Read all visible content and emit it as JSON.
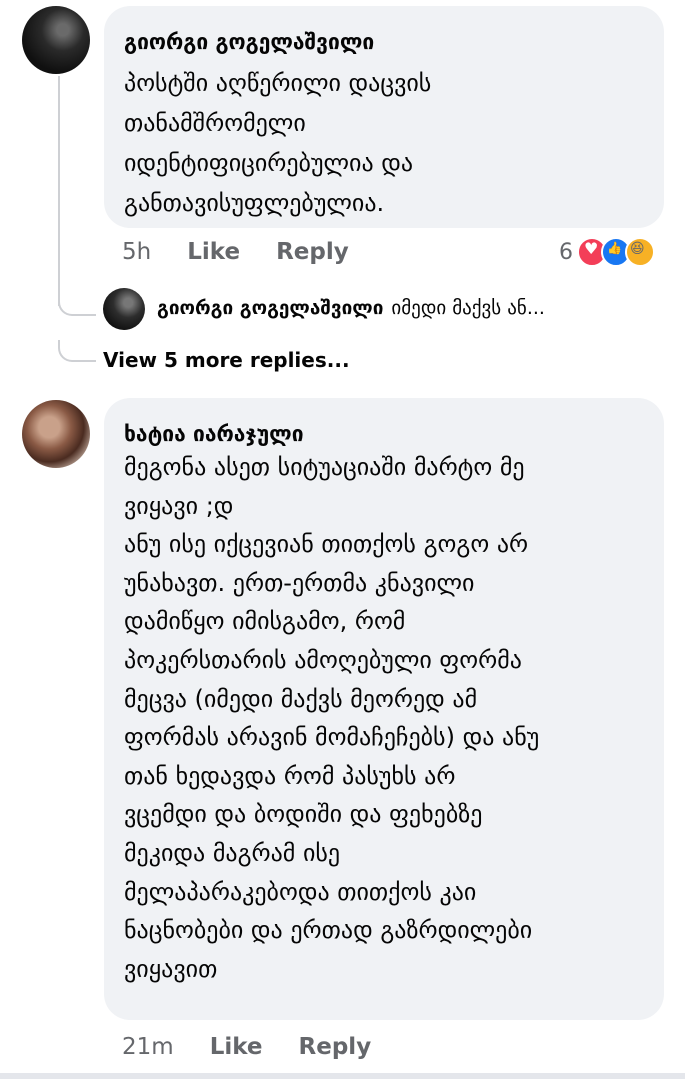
{
  "comments": [
    {
      "author": "გიორგი გოგელაშვილი",
      "text": "პოსტში აღწერილი დაცვის\nთანამშრომელი\nიდენტიფიცირებულია და\nგანთავისუფლებულია.",
      "time": "5h",
      "like_label": "Like",
      "reply_label": "Reply",
      "reaction_count": "6",
      "reactions": [
        "heart-icon",
        "like-icon",
        "haha-icon"
      ]
    },
    {
      "author": "ხატია იარაჯული",
      "text": "მეგონა ასეთ სიტუაციაში მარტო მე\nვიყავი ;დ\nანუ ისე იქცევიან თითქოს გოგო არ\nუნახავთ. ერთ-ერთმა კნავილი\nდამიწყო იმისგამო, რომ\nპოკერსთარის ამოღებული ფორმა\nმეცვა (იმედი მაქვს მეორედ ამ\nფორმას არავინ მომაჩეჩებს) და ანუ\nთან ხედავდა რომ პასუხს არ\nვცემდი და ბოდიში და ფეხებზე\nმეკიდა მაგრამ ისე\nმელაპარაკებოდა თითქოს კაი\nნაცნობები და ერთად გაზრდილები\nვიყავით",
      "time": "21m",
      "like_label": "Like",
      "reply_label": "Reply"
    }
  ],
  "reply_preview": {
    "author": "გიორგი გოგელაშვილი",
    "text": "იმედი მაქვს ან..."
  },
  "view_more_label": "View 5 more replies..."
}
